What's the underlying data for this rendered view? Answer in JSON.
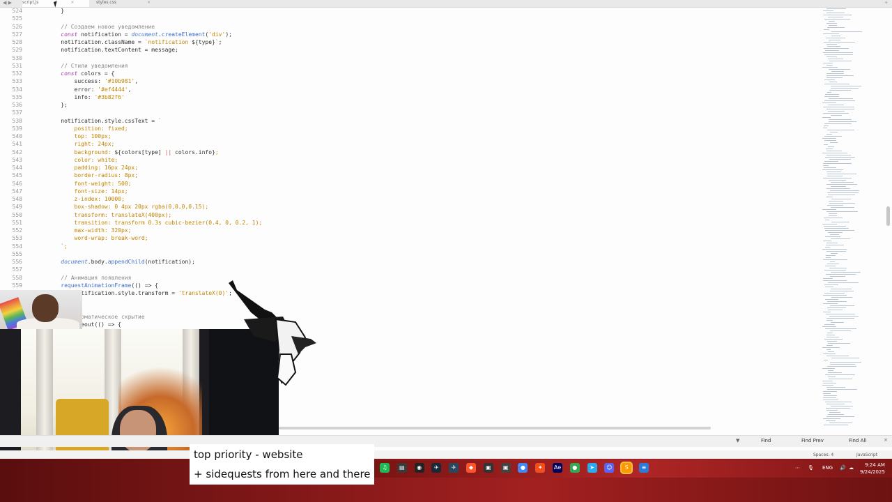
{
  "tabs": [
    {
      "label": "script.js",
      "active": true
    },
    {
      "label": "styles.css",
      "active": false
    }
  ],
  "editor": {
    "lines": [
      {
        "num": "524",
        "tokens": [
          {
            "t": "    }",
            "c": ""
          }
        ]
      },
      {
        "num": "525",
        "tokens": []
      },
      {
        "num": "526",
        "tokens": [
          {
            "t": "    // Создаем новое уведомление",
            "c": "c-cmt"
          }
        ]
      },
      {
        "num": "527",
        "tokens": [
          {
            "t": "    ",
            "c": ""
          },
          {
            "t": "const",
            "c": "c-kw"
          },
          {
            "t": " notification = ",
            "c": ""
          },
          {
            "t": "document",
            "c": "c-obj"
          },
          {
            "t": ".",
            "c": ""
          },
          {
            "t": "createElement",
            "c": "c-fn"
          },
          {
            "t": "(",
            "c": ""
          },
          {
            "t": "'div'",
            "c": "c-str"
          },
          {
            "t": ");",
            "c": ""
          }
        ]
      },
      {
        "num": "528",
        "tokens": [
          {
            "t": "    notification.className = ",
            "c": ""
          },
          {
            "t": "`notification ",
            "c": "c-str"
          },
          {
            "t": "${type}",
            "c": ""
          },
          {
            "t": "`",
            "c": "c-str"
          },
          {
            "t": ";",
            "c": ""
          }
        ]
      },
      {
        "num": "529",
        "tokens": [
          {
            "t": "    notification.textContent = message;",
            "c": ""
          }
        ]
      },
      {
        "num": "530",
        "tokens": []
      },
      {
        "num": "531",
        "tokens": [
          {
            "t": "    // Стили уведомления",
            "c": "c-cmt"
          }
        ]
      },
      {
        "num": "532",
        "tokens": [
          {
            "t": "    ",
            "c": ""
          },
          {
            "t": "const",
            "c": "c-kw"
          },
          {
            "t": " colors = {",
            "c": ""
          }
        ]
      },
      {
        "num": "533",
        "tokens": [
          {
            "t": "        success: ",
            "c": ""
          },
          {
            "t": "'#10b981'",
            "c": "c-str"
          },
          {
            "t": ",",
            "c": ""
          }
        ]
      },
      {
        "num": "534",
        "tokens": [
          {
            "t": "        error: ",
            "c": ""
          },
          {
            "t": "'#ef4444'",
            "c": "c-str"
          },
          {
            "t": ",",
            "c": ""
          }
        ]
      },
      {
        "num": "535",
        "tokens": [
          {
            "t": "        info: ",
            "c": ""
          },
          {
            "t": "'#3b82f6'",
            "c": "c-str"
          }
        ]
      },
      {
        "num": "536",
        "tokens": [
          {
            "t": "    };",
            "c": ""
          }
        ]
      },
      {
        "num": "537",
        "tokens": []
      },
      {
        "num": "538",
        "tokens": [
          {
            "t": "    notification.style.cssText = ",
            "c": ""
          },
          {
            "t": "`",
            "c": "c-str"
          }
        ]
      },
      {
        "num": "539",
        "tokens": [
          {
            "t": "        position: fixed;",
            "c": "c-str"
          }
        ]
      },
      {
        "num": "540",
        "tokens": [
          {
            "t": "        top: 100px;",
            "c": "c-str"
          }
        ]
      },
      {
        "num": "541",
        "tokens": [
          {
            "t": "        right: 24px;",
            "c": "c-str"
          }
        ]
      },
      {
        "num": "542",
        "tokens": [
          {
            "t": "        background: ",
            "c": "c-str"
          },
          {
            "t": "${colors[type] ",
            "c": ""
          },
          {
            "t": "||",
            "c": "c-op"
          },
          {
            "t": " colors.info}",
            "c": ""
          },
          {
            "t": ";",
            "c": "c-str"
          }
        ]
      },
      {
        "num": "543",
        "tokens": [
          {
            "t": "        color: white;",
            "c": "c-str"
          }
        ]
      },
      {
        "num": "544",
        "tokens": [
          {
            "t": "        padding: 16px 24px;",
            "c": "c-str"
          }
        ]
      },
      {
        "num": "545",
        "tokens": [
          {
            "t": "        border-radius: 8px;",
            "c": "c-str"
          }
        ]
      },
      {
        "num": "546",
        "tokens": [
          {
            "t": "        font-weight: 500;",
            "c": "c-str"
          }
        ]
      },
      {
        "num": "547",
        "tokens": [
          {
            "t": "        font-size: 14px;",
            "c": "c-str"
          }
        ]
      },
      {
        "num": "548",
        "tokens": [
          {
            "t": "        z-index: 10000;",
            "c": "c-str"
          }
        ]
      },
      {
        "num": "549",
        "tokens": [
          {
            "t": "        box-shadow: 0 4px 20px rgba(0,0,0,0.15);",
            "c": "c-str"
          }
        ]
      },
      {
        "num": "550",
        "tokens": [
          {
            "t": "        transform: translateX(400px);",
            "c": "c-str"
          }
        ]
      },
      {
        "num": "551",
        "tokens": [
          {
            "t": "        transition: transform 0.3s cubic-bezier(0.4, 0, 0.2, 1);",
            "c": "c-str"
          }
        ]
      },
      {
        "num": "552",
        "tokens": [
          {
            "t": "        max-width: 320px;",
            "c": "c-str"
          }
        ]
      },
      {
        "num": "553",
        "tokens": [
          {
            "t": "        word-wrap: break-word;",
            "c": "c-str"
          }
        ]
      },
      {
        "num": "554",
        "tokens": [
          {
            "t": "    `;",
            "c": "c-str"
          }
        ]
      },
      {
        "num": "555",
        "tokens": []
      },
      {
        "num": "556",
        "tokens": [
          {
            "t": "    ",
            "c": ""
          },
          {
            "t": "document",
            "c": "c-obj"
          },
          {
            "t": ".body.",
            "c": ""
          },
          {
            "t": "appendChild",
            "c": "c-fn"
          },
          {
            "t": "(notification);",
            "c": ""
          }
        ]
      },
      {
        "num": "557",
        "tokens": []
      },
      {
        "num": "558",
        "tokens": [
          {
            "t": "    // Анимация появления",
            "c": "c-cmt"
          }
        ]
      },
      {
        "num": "559",
        "tokens": [
          {
            "t": "    ",
            "c": ""
          },
          {
            "t": "requestAnimationFrame",
            "c": "c-fn"
          },
          {
            "t": "(() => {",
            "c": ""
          }
        ]
      },
      {
        "num": "560",
        "tokens": [
          {
            "t": "        notification.style.transform = ",
            "c": ""
          },
          {
            "t": "'translateX(0)'",
            "c": "c-str"
          },
          {
            "t": ";",
            "c": ""
          }
        ]
      },
      {
        "num": "561",
        "tokens": [
          {
            "t": "    });",
            "c": ""
          }
        ]
      },
      {
        "num": "562",
        "tokens": []
      },
      {
        "num": "563",
        "tokens": [
          {
            "t": "    // Автоматическое скрытие",
            "c": "c-cmt"
          }
        ]
      },
      {
        "num": "564",
        "tokens": [
          {
            "t": "    setTimeout(() => {",
            "c": ""
          }
        ]
      }
    ]
  },
  "findbar": {
    "find": "Find",
    "find_prev": "Find Prev",
    "find_all": "Find All"
  },
  "statusbar": {
    "spaces": "Spaces: 4",
    "syntax": "JavaScript"
  },
  "caption": {
    "line1": "top priority - website",
    "line2": "+ sidequests from here and there"
  },
  "tray": {
    "lang": "ENG",
    "time": "9:24 AM",
    "date": "9/24/2025"
  },
  "taskbar_icons": [
    {
      "name": "spotify-icon",
      "color": "#1db954",
      "glyph": "♫"
    },
    {
      "name": "notes-icon",
      "color": "#3a3a3a",
      "glyph": "▤"
    },
    {
      "name": "github-icon",
      "color": "#222222",
      "glyph": "◉"
    },
    {
      "name": "steam-icon",
      "color": "#1b2838",
      "glyph": "✈"
    },
    {
      "name": "steam-alt-icon",
      "color": "#2a475e",
      "glyph": "✈"
    },
    {
      "name": "brave-icon",
      "color": "#fb542b",
      "glyph": "◆"
    },
    {
      "name": "app-icon",
      "color": "#333333",
      "glyph": "▣"
    },
    {
      "name": "app-alt-icon",
      "color": "#444444",
      "glyph": "▣"
    },
    {
      "name": "chrome-icon",
      "color": "#4285f4",
      "glyph": "●"
    },
    {
      "name": "figma-icon",
      "color": "#f24e1e",
      "glyph": "✦"
    },
    {
      "name": "after-effects-icon",
      "color": "#00005b",
      "glyph": "Ae"
    },
    {
      "name": "chrome-alt-icon",
      "color": "#34a853",
      "glyph": "●"
    },
    {
      "name": "telegram-icon",
      "color": "#2aabee",
      "glyph": "➤"
    },
    {
      "name": "discord-icon",
      "color": "#5865f2",
      "glyph": "☺"
    },
    {
      "name": "sublime-text-icon",
      "color": "#ff9800",
      "glyph": "S",
      "active": true
    },
    {
      "name": "notepad-icon",
      "color": "#2b7bd9",
      "glyph": "≡"
    }
  ]
}
